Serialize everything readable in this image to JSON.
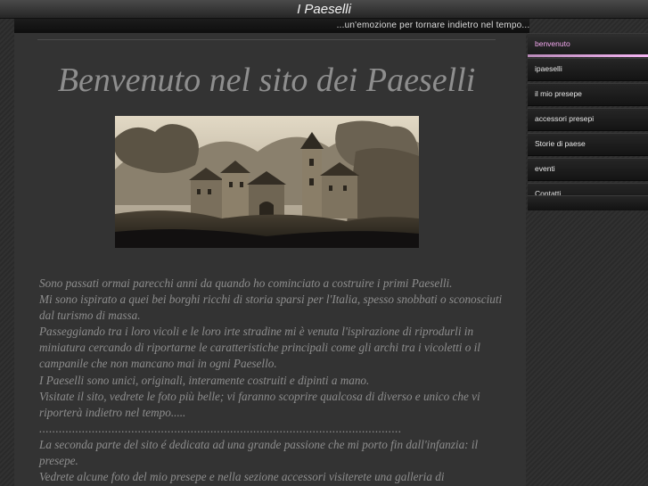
{
  "header": {
    "title": "I Paeselli",
    "tagline": "...un'emozione per tornare indietro nel tempo..."
  },
  "main": {
    "heading": "Benvenuto nel sito dei Paeselli",
    "paragraphs": [
      "Sono passati ormai parecchi anni da quando ho cominciato a costruire i primi Paeselli.",
      "Mi sono ispirato a quei bei borghi ricchi di storia sparsi per l'Italia, spesso snobbati o sconosciuti dal turismo di massa.",
      "Passeggiando tra i loro vicoli e le loro irte stradine mi è venuta l'ispirazione di riprodurli in miniatura cercando di riportarne le caratteristiche principali come gli archi tra i vicoletti o il campanile che non mancano mai in ogni Paesello.",
      "I Paeselli sono unici, originali, interamente costruiti e dipinti a mano.",
      "Visitate il sito, vedrete le foto più belle; vi faranno scoprire qualcosa di diverso e unico che vi riporterà indietro nel tempo.....",
      "..............................................................................................................",
      "La seconda parte del sito é dedicata ad una grande passione che mi porto fin dall'infanzia: il presepe.",
      "Vedrete alcune foto del mio presepe e nella sezione accessori visiterete una galleria di"
    ]
  },
  "sidebar": {
    "items": [
      {
        "label": "benvenuto"
      },
      {
        "label": "ipaeselli"
      },
      {
        "label": "il mio presepe"
      },
      {
        "label": "accessori presepi"
      },
      {
        "label": "Storie di paese"
      },
      {
        "label": "eventi"
      },
      {
        "label": "Contatti"
      }
    ]
  },
  "colors": {
    "background": "#2c2c2c",
    "panel": "#333333",
    "text": "#8d8d8d",
    "heading": "#8e8e8e",
    "nav_active_text": "#f2a7ee",
    "nav_active_underline": "#f6b6f4"
  }
}
